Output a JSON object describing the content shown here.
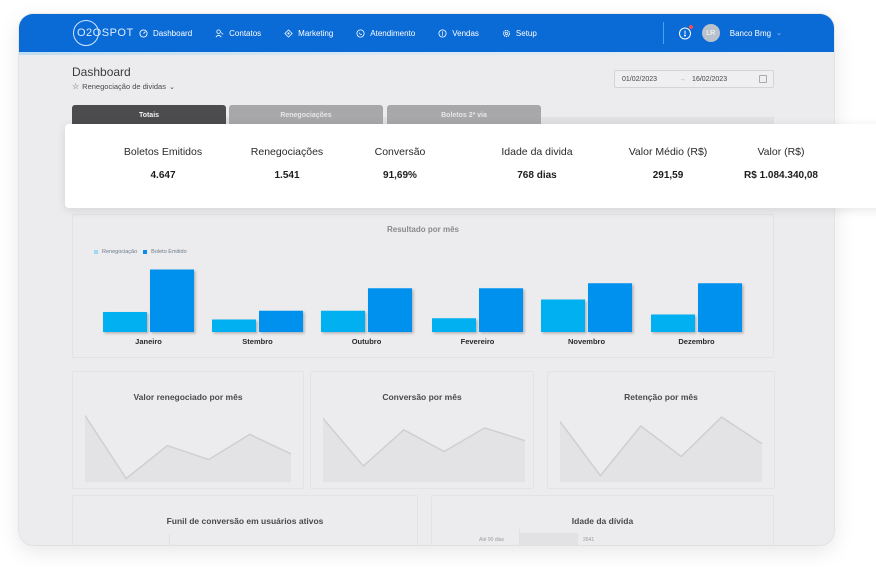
{
  "app": {
    "logo_text": "O2OSPOT",
    "nav": [
      {
        "label": "Dashboard",
        "icon": "dashboard-icon"
      },
      {
        "label": "Contatos",
        "icon": "contacts-icon"
      },
      {
        "label": "Marketing",
        "icon": "marketing-icon"
      },
      {
        "label": "Atendimento",
        "icon": "chat-icon"
      },
      {
        "label": "Vendas",
        "icon": "dollar-icon"
      },
      {
        "label": "Setup",
        "icon": "gear-icon"
      }
    ],
    "user_initials": "LR",
    "org_name": "Banco Bmg",
    "org_chevron": "⌄",
    "notification_indicator": true
  },
  "header": {
    "title": "Dashboard",
    "subtitle": "Renegociação de dividas",
    "subtitle_star": "☆",
    "subtitle_chevron": "⌄",
    "date_start": "01/02/2023",
    "date_arrow": "→",
    "date_end": "16/02/2023"
  },
  "tabs": [
    {
      "label": "Totais",
      "active": true
    },
    {
      "label": "Renegociações",
      "active": false
    },
    {
      "label": "Boletos 2ª via",
      "active": false
    }
  ],
  "totals_tag": "Totais",
  "totals": [
    {
      "label": "Boletos Emitidos",
      "value": "4.647"
    },
    {
      "label": "Renegociações",
      "value": "1.541"
    },
    {
      "label": "Conversão",
      "value": "91,69%"
    },
    {
      "label": "Idade da divida",
      "value": "768 dias"
    },
    {
      "label": "Valor Médio (R$)",
      "value": "291,59"
    },
    {
      "label": "Valor (R$)",
      "value": "R$ 1.084.340,08"
    }
  ],
  "colors": {
    "nav_bg": "#0a6ad6",
    "renegociacao": "#00b0f0",
    "boleto_emitido": "#0091ee",
    "tab_active": "#4c4c4e",
    "tab_inactive": "#a8a8aa",
    "notification": "#ff4a4a"
  },
  "chart_data": [
    {
      "type": "bar",
      "title": "Resultado por mês",
      "categories": [
        "Janeiro",
        "Stembro",
        "Outubro",
        "Fevereiro",
        "Novembro",
        "Dezembro"
      ],
      "series": [
        {
          "name": "Renegociação",
          "values": [
            16,
            10,
            17,
            11,
            26,
            14
          ]
        },
        {
          "name": "Boleto Emitido",
          "values": [
            50,
            17,
            35,
            35,
            39,
            39
          ]
        }
      ],
      "legend": "top-left",
      "ylim": [
        0,
        60
      ],
      "grid": false
    },
    {
      "type": "area",
      "title": "Valor renegociado por mês",
      "values": [
        95,
        5,
        52,
        32,
        68,
        40
      ],
      "ylim": [
        0,
        100
      ]
    },
    {
      "type": "area",
      "title": "Conversão por mês",
      "values": [
        100,
        25,
        82,
        48,
        85,
        65
      ],
      "ylim": [
        0,
        110
      ]
    },
    {
      "type": "area",
      "title": "Retenção por mês",
      "values": [
        95,
        10,
        88,
        40,
        102,
        60
      ],
      "ylim": [
        0,
        110
      ]
    },
    {
      "type": "bar",
      "title": "Idade da dívida",
      "categories": [
        "Até 90 dias"
      ],
      "values": [
        2641
      ]
    }
  ],
  "bottom": {
    "funnel_title": "Funil de conversão em usuários ativos"
  }
}
